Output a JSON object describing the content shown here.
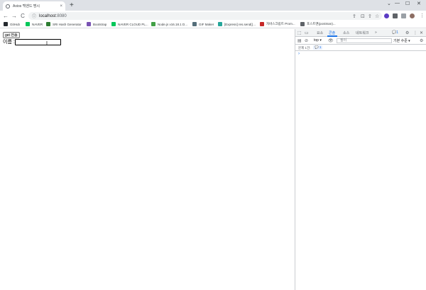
{
  "browser": {
    "tab_title": "Axios 백엔드 명시",
    "tab_close": "×",
    "new_tab": "+",
    "window_controls": [
      "⌄",
      "—",
      "☐",
      "✕"
    ],
    "nav": [
      "←",
      "→",
      "C"
    ],
    "url_host": "localhost",
    "url_port": ":8080",
    "toolbar_icons": [
      "⇪",
      "⊡",
      "⇧",
      "☆"
    ]
  },
  "bookmarks": [
    {
      "label": "GitHub",
      "color": "#24292e"
    },
    {
      "label": "NAVER",
      "color": "#03c75a"
    },
    {
      "label": "SRI Hash Generator",
      "color": "#2e7d32"
    },
    {
      "label": "Bootstrap",
      "color": "#7952b3"
    },
    {
      "label": "NAVER CLOUD PL...",
      "color": "#03c75a"
    },
    {
      "label": "Node.js v16.18.1 D...",
      "color": "#43a047"
    },
    {
      "label": "GIF Maker",
      "color": "#546e7a"
    },
    {
      "label": "[Express] res.send()...",
      "color": "#26a69a"
    },
    {
      "label": "자바스크립트 Prom...",
      "color": "#c62828"
    },
    {
      "label": "포스트맨(postman)...",
      "color": "#5f6368"
    }
  ],
  "page": {
    "get_button": "get 전송",
    "name_label": "이름 :",
    "name_value": "",
    "text_cursor": "I"
  },
  "devtools": {
    "tabs": [
      "요소",
      "콘솔",
      "소스",
      "네트워크",
      "»"
    ],
    "active_tab": "콘솔",
    "message_count": "1",
    "context": "top ▾",
    "filter_placeholder": "필터",
    "level": "기본 수준 ▾",
    "issues_label": "문제 1건:",
    "issues_count": "1",
    "prompt": "›"
  }
}
